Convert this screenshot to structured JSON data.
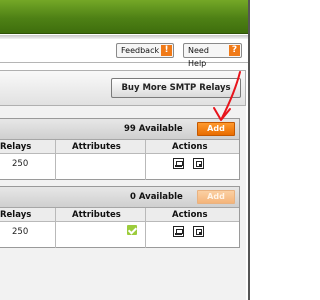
{
  "header": {
    "feedback_label": "Feedback",
    "feedback_badge": "!",
    "help_label": "Need Help",
    "help_badge": "?"
  },
  "panel": {
    "buy_more_label": "Buy More SMTP Relays"
  },
  "relay_blocks": [
    {
      "available_text": "99 Available",
      "add_label": "Add",
      "add_enabled": true,
      "columns": [
        "Relays",
        "Attributes",
        "Actions"
      ],
      "row": {
        "relays": "250",
        "attribute_check": false
      }
    },
    {
      "available_text": "0 Available",
      "add_label": "Add",
      "add_enabled": false,
      "columns": [
        "Relays",
        "Attributes",
        "Actions"
      ],
      "row": {
        "relays": "250",
        "attribute_check": true
      }
    }
  ],
  "colors": {
    "header_green": "#4e8115",
    "accent_orange": "#e86c00",
    "annotation_red": "#e8141c"
  }
}
